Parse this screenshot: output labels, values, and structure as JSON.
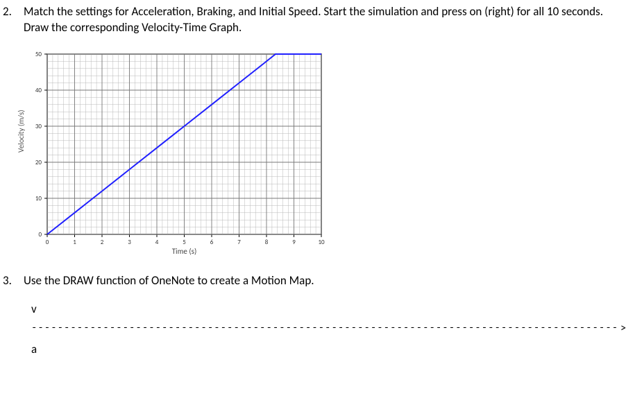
{
  "q2": {
    "number": "2.",
    "text": "Match the settings for Acceleration, Braking, and Initial Speed. Start the simulation and press on (right) for all 10 seconds. Draw the corresponding Velocity-Time Graph."
  },
  "q3": {
    "number": "3.",
    "text": "Use the DRAW function of OneNote to create a Motion Map."
  },
  "motion_map": {
    "v_label": "v",
    "a_label": "a",
    "dashes": "-----------------------------------------------------------------------------------------------------------------",
    "arrow": ">"
  },
  "chart_data": {
    "type": "line",
    "title": "",
    "xlabel": "Time (s)",
    "ylabel": "Velocity (m/s)",
    "xlim": [
      0,
      10
    ],
    "ylim": [
      0,
      50
    ],
    "x_ticks": [
      0,
      1,
      2,
      3,
      4,
      5,
      6,
      7,
      8,
      9,
      10
    ],
    "y_ticks": [
      0,
      10,
      20,
      30,
      40,
      50
    ],
    "series": [
      {
        "name": "velocity",
        "color": "#2020ff",
        "x": [
          0,
          1,
          2,
          3,
          4,
          5,
          6,
          7,
          8,
          8.33,
          9,
          10
        ],
        "values": [
          0,
          6,
          12,
          18,
          24,
          30,
          36,
          42,
          48,
          50,
          50,
          50
        ]
      }
    ],
    "grid": true
  }
}
